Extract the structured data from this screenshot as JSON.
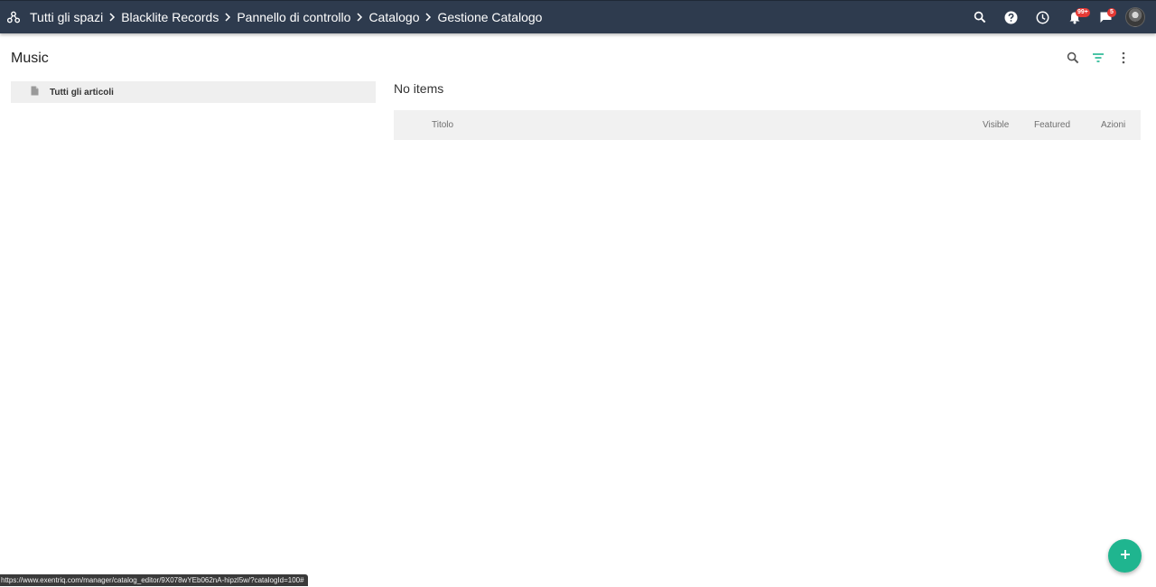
{
  "topbar": {
    "breadcrumbs": [
      "Tutti gli spazi",
      "Blacklite Records",
      "Pannello di controllo",
      "Catalogo",
      "Gestione Catalogo"
    ],
    "notifications_badge": "99+",
    "messages_badge": "5",
    "icons": {
      "spaces": "network-icon",
      "search": "search-icon",
      "help": "help-icon",
      "history": "clock-icon",
      "notifications": "bell-icon",
      "messages": "chat-icon"
    },
    "background": "#2e3b4e"
  },
  "page": {
    "title": "Music",
    "icons": [
      "search-icon",
      "filter-icon",
      "more-vert-icon"
    ]
  },
  "tree": {
    "items": [
      {
        "label": "Tutti gli articoli",
        "icon": "file-icon"
      }
    ]
  },
  "main": {
    "empty_text": "No items",
    "columns": [
      "Titolo",
      "Visible",
      "Featured",
      "Azioni"
    ]
  },
  "fab": {
    "icon": "plus-icon",
    "color": "#1fb58f"
  },
  "status": {
    "url": "https://www.exentriq.com/manager/catalog_editor/9X078wYEb062nA-hipzl5w/?catalogId=100#"
  }
}
